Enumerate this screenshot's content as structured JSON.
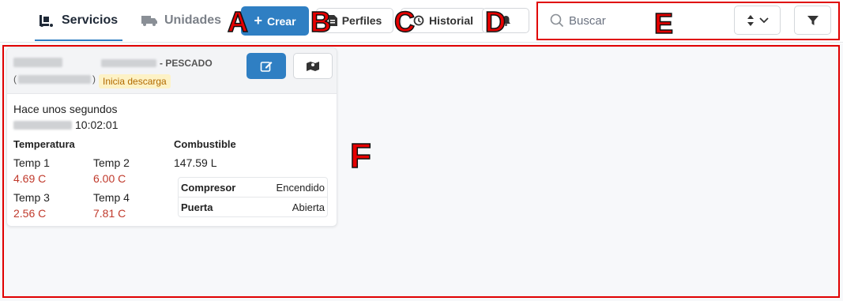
{
  "tabs": {
    "servicios": "Servicios",
    "unidades": "Unidades"
  },
  "toolbar": {
    "crear": "Crear",
    "perfiles": "Perfiles",
    "historial": "Historial"
  },
  "search": {
    "placeholder": "Buscar"
  },
  "markers": {
    "a": "A",
    "b": "B",
    "c": "C",
    "d": "D",
    "e": "E",
    "f": "F"
  },
  "card": {
    "cargo_suffix": "- PESCADO",
    "id_open": "(",
    "id_close": ")",
    "status": "Inicia descarga",
    "last_update": "Hace unos segundos",
    "time": "10:02:01",
    "temperature_title": "Temperatura",
    "temps": [
      {
        "label": "Temp 1",
        "value": "4.69 C"
      },
      {
        "label": "Temp 2",
        "value": "6.00 C"
      },
      {
        "label": "Temp 3",
        "value": "2.56 C"
      },
      {
        "label": "Temp 4",
        "value": "7.81 C"
      }
    ],
    "fuel_title": "Combustible",
    "fuel_value": "147.59 L",
    "states": [
      {
        "label": "Compresor",
        "value": "Encendido"
      },
      {
        "label": "Puerta",
        "value": "Abierta"
      }
    ]
  },
  "colors": {
    "accent": "#2f7fc3",
    "temp_value": "#c0392b",
    "badge_bg": "#fdf2c6",
    "marker": "#e60000"
  }
}
